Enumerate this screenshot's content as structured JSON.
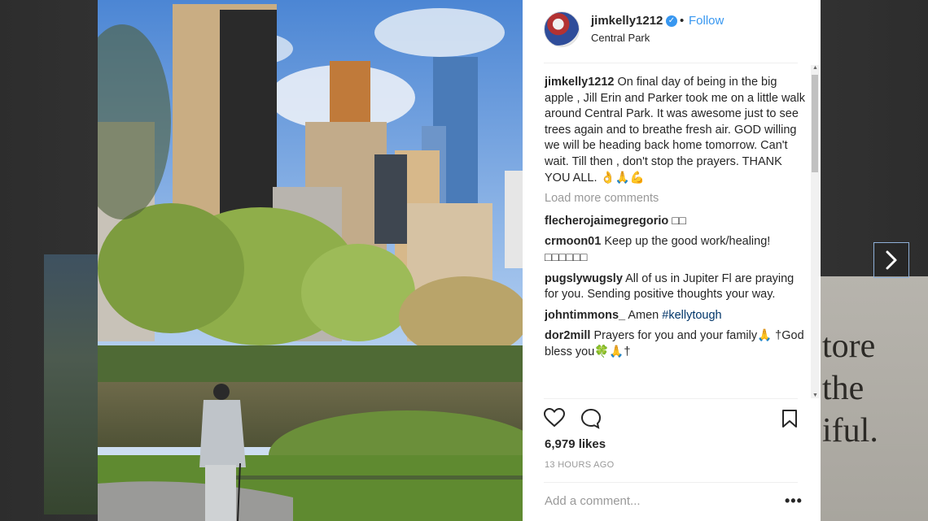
{
  "post": {
    "username": "jimkelly1212",
    "verified_icon": "verified-badge-icon",
    "separator": "•",
    "follow_label": "Follow",
    "location": "Central Park",
    "caption": "On final day of being in the big apple , Jill Erin and Parker took me on a little walk around Central Park. It was awesome just to see trees again and to breathe fresh air. GOD willing we will be heading back home tomorrow. Can't wait. Till then , don't stop the prayers. THANK YOU ALL. 👌🙏💪",
    "load_more_label": "Load more comments",
    "likes": "6,979 likes",
    "time_ago": "13 HOURS AGO",
    "add_comment_placeholder": "Add a comment...",
    "more_options": "•••"
  },
  "comments": [
    {
      "user": "flecherojaimegregorio",
      "text": "□□"
    },
    {
      "user": "crmoon01",
      "text": "Keep up the good work/healing! □□□□□□"
    },
    {
      "user": "pugslywugsly",
      "text": "All of us in Jupiter Fl are praying for you. Sending positive thoughts your way."
    },
    {
      "user": "johntimmons_",
      "text": "Amen",
      "hashtag": "#kellytough"
    },
    {
      "user": "dor2mill",
      "text": "Prayers for you and your family🙏 †God bless you🍀🙏†"
    }
  ],
  "background_words": [
    "tore",
    "the",
    "iful."
  ],
  "colors": {
    "link": "#3897f0",
    "text": "#262626",
    "muted": "#999999",
    "hashtag": "#003569"
  },
  "icons": [
    "heart-icon",
    "comment-icon",
    "bookmark-icon",
    "chevron-right-icon"
  ]
}
